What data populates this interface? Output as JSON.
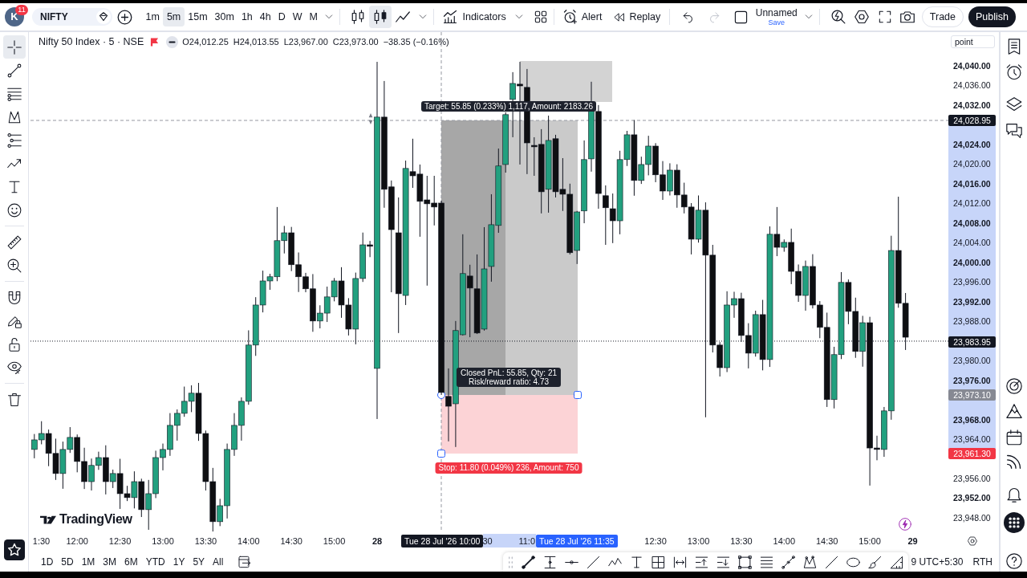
{
  "top_bar": {
    "avatar": {
      "initial": "K",
      "badge": "11"
    },
    "symbol": "NIFTY",
    "intervals": [
      {
        "label": "1m",
        "selected": false
      },
      {
        "label": "5m",
        "selected": true
      },
      {
        "label": "15m",
        "selected": false
      },
      {
        "label": "30m",
        "selected": false
      },
      {
        "label": "1h",
        "selected": false
      },
      {
        "label": "4h",
        "selected": false
      },
      {
        "label": "D",
        "selected": false
      },
      {
        "label": "W",
        "selected": false
      },
      {
        "label": "M",
        "selected": false
      }
    ],
    "chart_styles": [
      {
        "kind": "hollow-candles",
        "selected": false
      },
      {
        "kind": "candles",
        "selected": true
      },
      {
        "kind": "line",
        "selected": false
      }
    ],
    "indicators": "Indicators",
    "alert": "Alert",
    "replay": "Replay",
    "history": [
      {
        "kind": "undo",
        "disabled": false
      },
      {
        "kind": "redo",
        "disabled": true
      }
    ],
    "layout": {
      "name": "Unnamed",
      "save": "Save"
    },
    "trade": "Trade",
    "publish": "Publish"
  },
  "left_toolbar": {
    "groups": [
      {
        "tools": [
          {
            "kind": "crosshair",
            "selected": true
          },
          {
            "kind": "trend-line",
            "selected": false
          },
          {
            "kind": "fib",
            "selected": false
          },
          {
            "kind": "pattern",
            "selected": false
          },
          {
            "kind": "position",
            "selected": false
          },
          {
            "kind": "path",
            "selected": false
          },
          {
            "kind": "text",
            "selected": false
          },
          {
            "kind": "emoji",
            "selected": false
          }
        ]
      },
      {
        "tools": [
          {
            "kind": "ruler",
            "selected": false
          },
          {
            "kind": "zoom",
            "selected": false
          }
        ]
      },
      {
        "tools": [
          {
            "kind": "magnet",
            "selected": false
          },
          {
            "kind": "lock-drawing",
            "selected": false
          },
          {
            "kind": "lock",
            "selected": false
          },
          {
            "kind": "hide",
            "selected": false
          }
        ]
      },
      {
        "tools": [
          {
            "kind": "trash",
            "selected": false
          }
        ]
      }
    ]
  },
  "legend": {
    "title": "Nifty 50 Index · 5 · NSE",
    "values": [
      "O24,012.25",
      "H24,013.55",
      "L23,967.00",
      "C23,973.00"
    ],
    "change": "−38.35 (−0.16%)"
  },
  "chart": {
    "scale_mode": "point",
    "logo": "TradingView",
    "position": {
      "target": "Target: 55.85 (0.233%) 1,117, Amount: 2183.26",
      "result": [
        "Closed PnL: 55.85, Qty: 21",
        "Risk/reward ratio: 4.73"
      ],
      "stop": "Stop: 11.80 (0.049%) 236, Amount: 750"
    },
    "chart_data": {
      "type": "candlestick",
      "ylim": [
        23945.05,
        24046.85
      ],
      "yticks": [
        {
          "value": 24040,
          "label": "24,040.00"
        },
        {
          "value": 24036,
          "label": "24,036.00"
        },
        {
          "value": 24032,
          "label": "24,032.00"
        },
        {
          "value": 24024,
          "label": "24,024.00"
        },
        {
          "value": 24020,
          "label": "24,020.00"
        },
        {
          "value": 24016,
          "label": "24,016.00"
        },
        {
          "value": 24012,
          "label": "24,012.00"
        },
        {
          "value": 24008,
          "label": "24,008.00"
        },
        {
          "value": 24004,
          "label": "24,004.00"
        },
        {
          "value": 24000,
          "label": "24,000.00"
        },
        {
          "value": 23996,
          "label": "23,996.00"
        },
        {
          "value": 23992,
          "label": "23,992.00"
        },
        {
          "value": 23988,
          "label": "23,988.00"
        },
        {
          "value": 23980,
          "label": "23,980.00"
        },
        {
          "value": 23976,
          "label": "23,976.00"
        },
        {
          "value": 23968,
          "label": "23,968.00"
        },
        {
          "value": 23964,
          "label": "23,964.00"
        },
        {
          "value": 23956,
          "label": "23,956.00"
        },
        {
          "value": 23952,
          "label": "23,952.00"
        },
        {
          "value": 23948,
          "label": "23,948.00"
        }
      ],
      "ref_lines": [
        {
          "axis": "y",
          "value": 23983.95
        }
      ],
      "categories": [
        null,
        null,
        null,
        null,
        null,
        null,
        "12:00",
        null,
        null,
        null,
        null,
        null,
        "12:30",
        null,
        null,
        null,
        null,
        null,
        "13:00",
        null,
        null,
        null,
        null,
        null,
        "13:30",
        null,
        null,
        null,
        null,
        null,
        "14:00",
        null,
        null,
        null,
        null,
        null,
        "14:30",
        null,
        null,
        null,
        null,
        null,
        "15:00",
        null,
        null,
        null,
        null,
        null,
        "28",
        null,
        null,
        null,
        null,
        null,
        null,
        null,
        null,
        null,
        null,
        null,
        null,
        null,
        null,
        null,
        null,
        null,
        null,
        null,
        null,
        null,
        null,
        null,
        null,
        null,
        null,
        null,
        null,
        null,
        null,
        null,
        null,
        null,
        null,
        null,
        null,
        null,
        null,
        "12:30",
        null,
        null,
        null,
        null,
        null,
        "13:00",
        null,
        null,
        null,
        null,
        null,
        "13:30",
        null,
        null,
        null,
        null,
        null,
        "14:00",
        null,
        null,
        null,
        null,
        null,
        "14:30",
        null,
        null,
        null,
        null,
        null,
        "15:00",
        null,
        null,
        null,
        null,
        null
      ],
      "ohlc": [
        [
          23961.9,
          23965.05,
          23960.1,
          23963.85
        ],
        [
          23963.85,
          23967.65,
          23962.95,
          23965.15
        ],
        [
          23965.15,
          23965.95,
          23958.5,
          23961.1
        ],
        [
          23961.1,
          23964.1,
          23955.7,
          23957.0
        ],
        [
          23957.0,
          23963.5,
          23953.9,
          23961.9
        ],
        [
          23961.9,
          23966.45,
          23961.2,
          23964.35
        ],
        [
          23964.35,
          23964.95,
          23957.25,
          23959.45
        ],
        [
          23959.45,
          23962.25,
          23953.85,
          23955.35
        ],
        [
          23955.35,
          23960.05,
          23953.55,
          23958.65
        ],
        [
          23958.65,
          23961.45,
          23957.75,
          23960.25
        ],
        [
          23960.25,
          23962.75,
          23952.75,
          23955.35
        ],
        [
          23955.35,
          23957.8,
          23954.05,
          23957.0
        ],
        [
          23957.0,
          23960.0,
          23949.8,
          23952.9
        ],
        [
          23952.9,
          23954.5,
          23951.4,
          23952.1
        ],
        [
          23952.1,
          23957.45,
          23949.9,
          23955.35
        ],
        [
          23955.35,
          23955.95,
          23948.15,
          23949.65
        ],
        [
          23949.65,
          23955.7,
          23945.55,
          23952.9
        ],
        [
          23952.9,
          23961.65,
          23952.0,
          23960.25
        ],
        [
          23960.25,
          23963.1,
          23957.65,
          23961.9
        ],
        [
          23961.9,
          23969.3,
          23960.6,
          23966.8
        ],
        [
          23966.8,
          23970.05,
          23963.7,
          23969.25
        ],
        [
          23969.25,
          23974.7,
          23968.55,
          23971.7
        ],
        [
          23971.7,
          23974.95,
          23969.5,
          23973.35
        ],
        [
          23973.35,
          23975.45,
          23963.65,
          23965.15
        ],
        [
          23965.15,
          23965.75,
          23953.55,
          23955.35
        ],
        [
          23955.35,
          23958.15,
          23945.2,
          23947.2
        ],
        [
          23947.2,
          23951.85,
          23946.3,
          23950.45
        ],
        [
          23950.45,
          23963.1,
          23947.85,
          23961.9
        ],
        [
          23961.9,
          23969.3,
          23960.6,
          23966.8
        ],
        [
          23966.8,
          23972.5,
          23963.7,
          23971.7
        ],
        [
          23971.7,
          23986.15,
          23971.0,
          23983.15
        ],
        [
          23983.15,
          23992.9,
          23980.95,
          23991.3
        ],
        [
          23991.3,
          23998.3,
          23989.8,
          23996.2
        ],
        [
          23996.2,
          23997.65,
          23994.4,
          23997.05
        ],
        [
          23997.05,
          24011.25,
          23996.15,
          24004.4
        ],
        [
          24004.4,
          24007.4,
          24001.8,
          24006.0
        ],
        [
          24006.0,
          24007.2,
          23998.2,
          23999.5
        ],
        [
          23999.5,
          24002.0,
          23993.95,
          23997.05
        ],
        [
          23997.05,
          23997.85,
          23993.9,
          23994.6
        ],
        [
          23994.6,
          23997.6,
          23985.85,
          23988.05
        ],
        [
          23988.05,
          23991.25,
          23986.55,
          23989.65
        ],
        [
          23989.65,
          23995.05,
          23987.85,
          23992.95
        ],
        [
          23992.95,
          23996.8,
          23992.05,
          23996.2
        ],
        [
          23996.2,
          23999.0,
          23988.7,
          23991.3
        ],
        [
          23991.3,
          23992.7,
          23985.1,
          23986.4
        ],
        [
          23986.4,
          23997.9,
          23983.3,
          23996.7
        ],
        [
          23996.7,
          24006.05,
          23996.0,
          24003.55
        ],
        [
          24003.55,
          24004.35,
          24001.05,
          24003.25
        ],
        [
          23978.4,
          24040.8,
          23968.1,
          24029.55
        ],
        [
          24029.55,
          24036.9,
          24011.1,
          24014.85
        ],
        [
          24015.35,
          24016.65,
          23993.9,
          24006.65
        ],
        [
          24006.0,
          24013.2,
          23985.6,
          23993.6
        ],
        [
          23993.25,
          24020.7,
          23991.3,
          24019.1
        ],
        [
          24018.45,
          24025.15,
          24015.15,
          24017.6
        ],
        [
          24017.95,
          24019.9,
          24005.2,
          24012.4
        ],
        [
          24012.7,
          24017.6,
          23995.25,
          24011.9
        ],
        [
          24012.05,
          24017.6,
          24007.5,
          24011.25
        ],
        [
          24012.05,
          24012.55,
          23973.0,
          23973.5
        ],
        [
          23972.7,
          23978.4,
          23963.55,
          23970.7
        ],
        [
          23971.2,
          23988.05,
          23962.4,
          23986.1
        ],
        [
          23985.25,
          24005.7,
          23985.1,
          23997.7
        ],
        [
          23997.2,
          23999.5,
          23984.75,
          23994.75
        ],
        [
          23994.6,
          24001.6,
          23985.4,
          23985.6
        ],
        [
          23986.4,
          24007.15,
          23986.1,
          23998.65
        ],
        [
          23999.15,
          24013.85,
          23996.05,
          24007.65
        ],
        [
          24007.5,
          24023.15,
          24006.0,
          24019.6
        ],
        [
          24019.9,
          24030.55,
          24018.25,
          24030.05
        ],
        [
          24033.15,
          24038.7,
          24025.45,
          24036.4
        ],
        [
          24036.25,
          24040.8,
          24019.9,
          24035.9
        ],
        [
          24035.6,
          24039.35,
          24017.95,
          24024.3
        ],
        [
          24023.8,
          24025.45,
          24017.6,
          24023.5
        ],
        [
          24024.0,
          24027.1,
          24009.95,
          24014.35
        ],
        [
          24014.85,
          24029.85,
          24010.1,
          24024.8
        ],
        [
          24025.15,
          24025.95,
          24013.2,
          24014.35
        ],
        [
          24014.85,
          24021.2,
          24010.45,
          24013.85
        ],
        [
          24013.85,
          24016.0,
          24001.6,
          24001.95
        ],
        [
          24002.4,
          24010.45,
          23999.65,
          24010.25
        ],
        [
          24010.45,
          24024.8,
          24007.95,
          24020.9
        ],
        [
          24021.05,
          24036.75,
          24018.45,
          24030.85
        ],
        [
          24030.7,
          24032.0,
          24010.9,
          24014.0
        ],
        [
          24013.55,
          24015.65,
          24003.55,
          24011.1
        ],
        [
          24010.9,
          24014.0,
          24003.9,
          24008.45
        ],
        [
          24008.45,
          24022.7,
          24005.7,
          24020.9
        ],
        [
          24020.9,
          24026.75,
          24019.6,
          24025.95
        ],
        [
          24025.95,
          24028.95,
          24013.55,
          24016.65
        ],
        [
          24016.65,
          24021.5,
          24015.95,
          24019.9
        ],
        [
          24019.9,
          24025.75,
          24017.7,
          24023.65
        ],
        [
          24023.65,
          24024.25,
          24016.3,
          24017.8
        ],
        [
          24017.8,
          24020.6,
          24012.7,
          24014.5
        ],
        [
          24014.5,
          24020.15,
          24013.6,
          24018.75
        ],
        [
          24018.75,
          24019.95,
          24011.1,
          24013.7
        ],
        [
          24013.7,
          24016.2,
          24009.95,
          24011.25
        ],
        [
          24011.25,
          24012.05,
          24001.6,
          24004.7
        ],
        [
          24004.7,
          24013.6,
          24004.0,
          24010.6
        ],
        [
          24010.6,
          24012.2,
          23968.45,
          24001.45
        ],
        [
          24001.45,
          24003.55,
          23981.65,
          23983.15
        ],
        [
          23983.15,
          23983.75,
          23976.75,
          23978.55
        ],
        [
          23978.55,
          23994.1,
          23977.65,
          23991.3
        ],
        [
          23991.3,
          23994.0,
          23988.7,
          23992.6
        ],
        [
          23992.6,
          23993.8,
          23983.8,
          23985.1
        ],
        [
          23985.1,
          23987.6,
          23978.4,
          23981.5
        ],
        [
          23981.5,
          23990.15,
          23980.8,
          23989.35
        ],
        [
          23989.35,
          23992.35,
          23978.0,
          23980.2
        ],
        [
          23980.2,
          24007.3,
          23978.7,
          24005.7
        ],
        [
          24005.7,
          24011.25,
          24001.25,
          24003.05
        ],
        [
          24003.05,
          24004.65,
          24002.15,
          24004.05
        ],
        [
          24004.05,
          24006.85,
          23995.55,
          23998.15
        ],
        [
          23998.15,
          23999.55,
          23991.95,
          23993.25
        ],
        [
          23993.25,
          24000.35,
          23990.15,
          23999.15
        ],
        [
          23999.15,
          24001.65,
          23990.6,
          23991.3
        ],
        [
          23991.3,
          23992.1,
          23984.55,
          23986.75
        ],
        [
          23986.75,
          23989.75,
          23970.55,
          23972.05
        ],
        [
          23972.05,
          23982.8,
          23970.25,
          23981.2
        ],
        [
          23981.2,
          23998.0,
          23980.3,
          23995.9
        ],
        [
          23995.9,
          23996.5,
          23987.4,
          23990.0
        ],
        [
          23990.0,
          23992.8,
          23980.55,
          23981.85
        ],
        [
          23981.85,
          23989.1,
          23978.75,
          23987.7
        ],
        [
          23987.7,
          23988.9,
          23954.55,
          23962.2
        ],
        [
          23962.2,
          23964.7,
          23959.7,
          23961.9
        ],
        [
          23961.9,
          23970.55,
          23960.4,
          23969.75
        ],
        [
          23969.75,
          24005.4,
          23967.95,
          24002.4
        ],
        [
          24002.4,
          24013.35,
          23990.75,
          23991.65
        ],
        [
          23991.65,
          23993.75,
          23982.15,
          23984.75
        ]
      ]
    }
  },
  "price_axis": {
    "label_styles": [
      {
        "major": true
      },
      {
        "major": false
      },
      {
        "major": true
      },
      {
        "major": true
      },
      {
        "major": false
      },
      {
        "major": true
      },
      {
        "major": false
      },
      {
        "major": true
      },
      {
        "major": false
      },
      {
        "major": true
      },
      {
        "major": false
      },
      {
        "major": true
      },
      {
        "major": false
      },
      {
        "major": false
      },
      {
        "major": true
      },
      {
        "major": true
      },
      {
        "major": false
      },
      {
        "major": false
      },
      {
        "major": true
      },
      {
        "major": false
      }
    ],
    "markers": [
      {
        "text": "24,028.95",
        "color": "#131722"
      },
      {
        "text": "23,983.95",
        "color": "#131722"
      },
      {
        "text": "23,973.10",
        "color": "#868993"
      },
      {
        "text": "23,961.30",
        "color": "#f23645"
      }
    ]
  },
  "time_axis": {
    "label_styles": [
      {
        "major": false
      },
      {
        "major": false
      },
      {
        "major": false
      },
      {
        "major": false
      },
      {
        "major": false
      },
      {
        "major": false
      },
      {
        "major": false
      },
      {
        "major": true
      },
      {
        "major": false
      },
      {
        "major": false
      },
      {
        "major": false
      },
      {
        "major": false
      },
      {
        "major": false
      },
      {
        "major": false
      }
    ],
    "clipped_labels": [
      {
        "text": "1:30",
        "major": false
      },
      {
        "text": "30",
        "major": false
      },
      {
        "text": "11:0",
        "major": false
      }
    ],
    "next_day_label": {
      "text": "29",
      "major": true
    },
    "cursor_labels": [
      {
        "text": "Tue 28 Jul '26 10:00",
        "color": "#131722"
      },
      {
        "text": "Tue 28 Jul '26 11:35",
        "color": "#2962ff"
      }
    ]
  },
  "bottom_bar": {
    "ranges": [
      "1D",
      "5D",
      "1M",
      "3M",
      "6M",
      "YTD",
      "1Y",
      "5Y",
      "All"
    ],
    "clock": "9 UTC+5:30",
    "session": "RTH"
  }
}
